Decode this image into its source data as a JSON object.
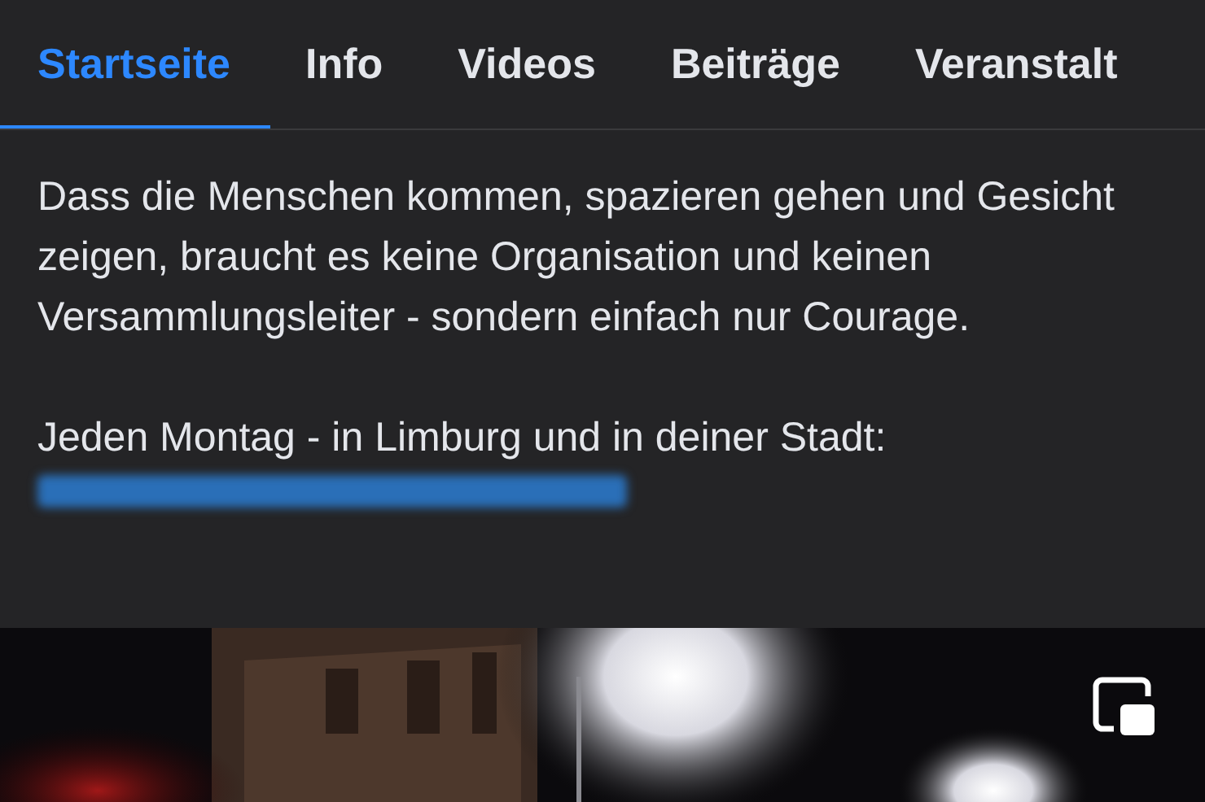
{
  "tabs": [
    {
      "label": "Startseite",
      "selected": true
    },
    {
      "label": "Info",
      "selected": false
    },
    {
      "label": "Videos",
      "selected": false
    },
    {
      "label": "Beiträge",
      "selected": false
    },
    {
      "label": "Veranstalt",
      "selected": false
    }
  ],
  "post": {
    "paragraphs": [
      "Dass die Menschen kommen, spazieren gehen und Gesicht zeigen, braucht es keine Organisation und keinen Versammlungsleiter - sondern einfach nur Courage.",
      "Jeden Montag - in Limburg und in deiner Stadt:"
    ]
  }
}
